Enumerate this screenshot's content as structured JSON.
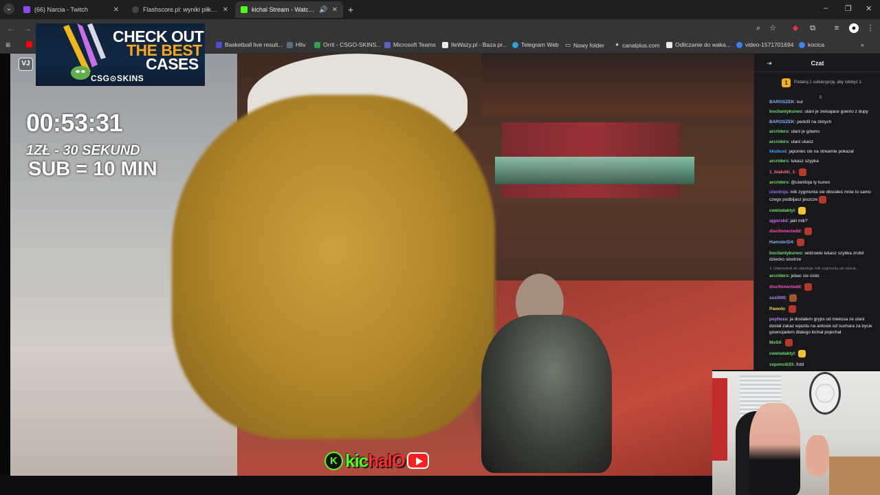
{
  "browser": {
    "tabs": [
      {
        "title": "(66) Narcia - Twitch",
        "favicon_color": "#9146ff",
        "active": false
      },
      {
        "title": "Flashscore.pl: wyniki piłki nożnej",
        "favicon_color": "#1a1a1a",
        "active": false
      },
      {
        "title": "kichal Stream - Watch Live",
        "favicon_color": "#53fc18",
        "active": true
      }
    ],
    "new_tab": "+",
    "window_controls": {
      "minimize": "–",
      "restore": "❐",
      "close": "✕"
    },
    "bookmarks": [
      {
        "label": "Basketball live result...",
        "color": "#4a4fd1"
      },
      {
        "label": "Hltv",
        "color": "#5b6b82"
      },
      {
        "label": "Orrti - CSGO-SKINS...",
        "color": "#2fa34a"
      },
      {
        "label": "Microsoft Teams",
        "color": "#5b5fc7"
      },
      {
        "label": "IleWazy.pl - Baza pr...",
        "color": "#e9e9e9"
      },
      {
        "label": "Telegram Web",
        "color": "#2aa3e0"
      },
      {
        "label": "Nowy folder",
        "color": "#d8d8d8"
      },
      {
        "label": "canalplus.com",
        "color": "#d8d8d8"
      },
      {
        "label": "Odliczanie do waka...",
        "color": "#e9e9e9"
      },
      {
        "label": "video-1571701694",
        "color": "#3b82f6"
      },
      {
        "label": "kocica",
        "color": "#3b82f6"
      }
    ]
  },
  "stream": {
    "promo": {
      "line1": "CHECK OUT",
      "line2": "THE BEST",
      "line3": "CASES",
      "brand": "CSG⊙SKINS"
    },
    "vj_logo": "VJ",
    "timer": "00:53:31",
    "rate": "1ZŁ - 30 SEKUND",
    "sub_rule": "SUB = 10 MIN",
    "channel_badge": "K",
    "channel_name_green": "kic",
    "channel_name_red": "hal",
    "channel_name_tail": "O"
  },
  "chat": {
    "title": "Czat",
    "gift_badge": "1",
    "gift_text": "Podaruj 1 subskrypcję, aby zdobyć 1.",
    "messages": [
      {
        "user": "BAROSZEK",
        "color": "#7fb2ff",
        "text": "kur"
      },
      {
        "user": "bocilantykurwo",
        "color": "#6ee06e",
        "text": "ulani je zwisajace gowno z dupy"
      },
      {
        "user": "BAROSZEK",
        "color": "#7fb2ff",
        "text": "pedofil na złotych"
      },
      {
        "user": "arcriders",
        "color": "#6ee06e",
        "text": "ulani je gówno"
      },
      {
        "user": "arcriders",
        "color": "#6ee06e",
        "text": "ulani ukasz"
      },
      {
        "user": "kkubust",
        "color": "#3fa9ff",
        "text": "japoniec cie na streamie pokazal"
      },
      {
        "user": "arcriders",
        "color": "#6ee06e",
        "text": "lukasz szypka"
      },
      {
        "user": "1_bialutki_1",
        "color": "#ff6a9a",
        "text": "",
        "emote": "#b33a2a"
      },
      {
        "user": "arcriders",
        "color": "#6ee06e",
        "text": "@ulanitoja ty kurwo"
      },
      {
        "user": "ulanitoja",
        "color": "#9a6bff",
        "text": "mik zygmunta sie obsrałeś mnie to samo czego podbijasz jeszcze",
        "emote": "#b33a2a"
      },
      {
        "user": "cwelodaktyl",
        "color": "#6ee06e",
        "text": "",
        "emote": "#f2c232"
      },
      {
        "user": "ajgorskii",
        "color": "#d56bff",
        "text": "jaki mik?"
      },
      {
        "user": "disc0nnectedd",
        "color": "#ff4fc6",
        "text": "",
        "emote": "#b33a2a"
      },
      {
        "user": "HamsterD4",
        "color": "#7fb2ff",
        "text": "",
        "emote": "#b33a2a"
      },
      {
        "user": "bocilantykurwo",
        "color": "#6ee06e",
        "text": "widzowie lukasz szybka zrobil dziecko siostrze"
      },
      {
        "user": "",
        "color": "#8a8a92",
        "text": "↳ Odpowiedź do ulanitoja: mik zygmunta sie obsrał...",
        "reply": true
      },
      {
        "user": "arcriders",
        "color": "#6ee06e",
        "text": "jebac cie cioto"
      },
      {
        "user": "disc0nnectedd",
        "color": "#ff4fc6",
        "text": "",
        "emote": "#b33a2a"
      },
      {
        "user": "suzi000",
        "color": "#b98aff",
        "text": "",
        "emote": "#a0562c"
      },
      {
        "user": "Pawolo",
        "color": "#ffd04a",
        "text": "",
        "emote": "#b33a2a"
      },
      {
        "user": "psyhoza",
        "color": "#c08bff",
        "text": "ja dostałem gryps od mietusa ze ulani dostał zakaz wjazdu na antosie od suchara za bycie gownojadem dlatego kichał pojechał"
      },
      {
        "user": "MsS4",
        "color": "#6ee06e",
        "text": "",
        "emote": "#b33a2a"
      },
      {
        "user": "cwelodaktyl",
        "color": "#6ee06e",
        "text": "",
        "emote": "#f2c232"
      },
      {
        "user": "szponcik33",
        "color": "#6ee06e",
        "text": "Xdd"
      }
    ]
  }
}
